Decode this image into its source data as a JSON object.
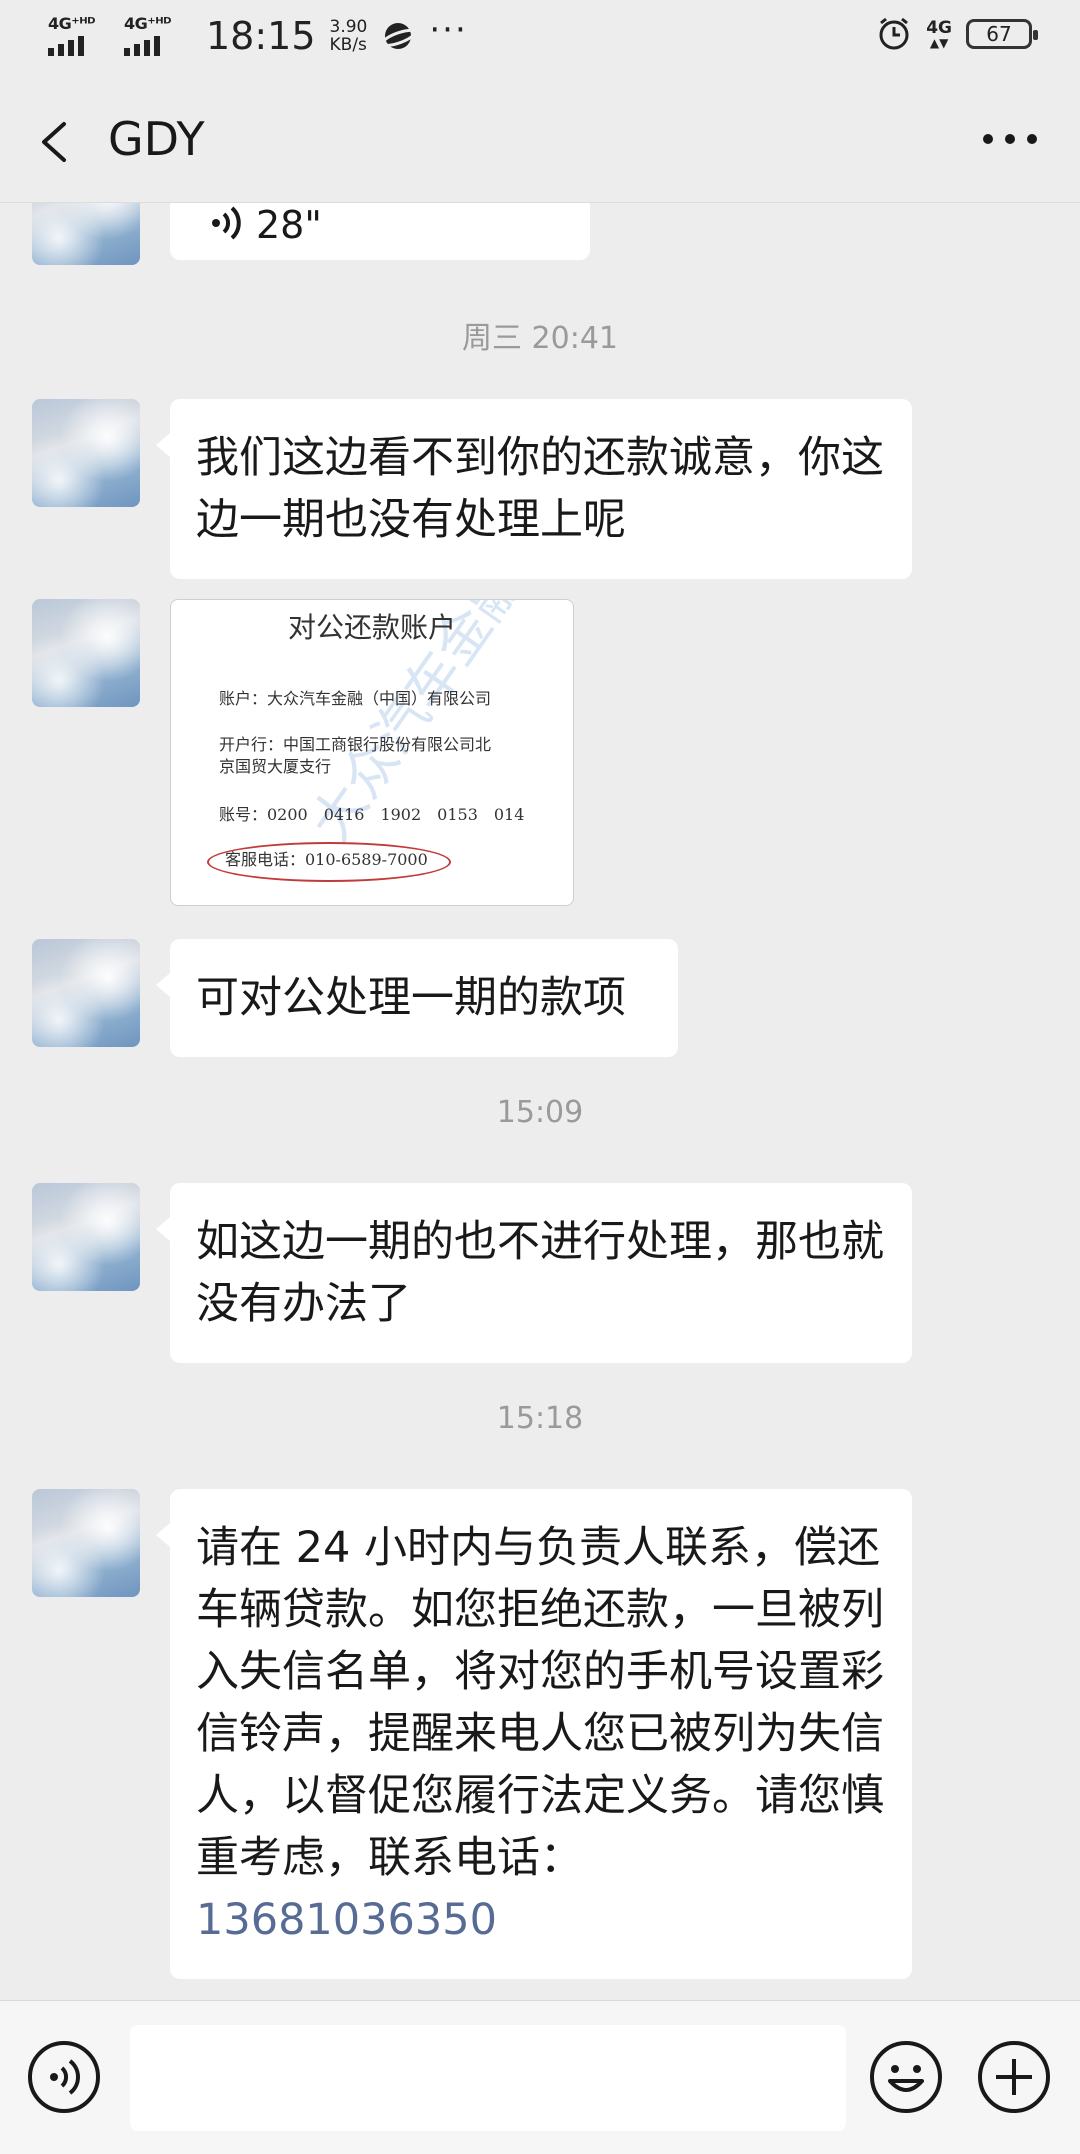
{
  "status_bar": {
    "sim1": "4G⁺ᴴᴰ",
    "sim2": "4G⁺ᴴᴰ",
    "time": "18:15",
    "speed_value": "3.90",
    "speed_unit": "KB/s",
    "network": "4G",
    "battery": "67"
  },
  "header": {
    "title": "GDY"
  },
  "messages": {
    "voice_length": "28\"",
    "time1": "周三 20:41",
    "msg1": "我们这边看不到你的还款诚意，你这边一期也没有处理上呢",
    "image": {
      "title": "对公还款账户",
      "line1": "账户：大众汽车金融（中国）有限公司",
      "line2a": "开户行：中国工商银行股份有限公司北",
      "line2b": "京国贸大厦支行",
      "line3": "账号：0200　0416　1902　0153　014",
      "line4": "客服电话：010-6589-7000",
      "watermark": "大众汽车金融"
    },
    "msg2": "可对公处理一期的款项",
    "time2": "15:09",
    "msg3": "如这边一期的也不进行处理，那也就没有办法了",
    "time3": "15:18",
    "msg4_text": "请在 24 小时内与负责人联系，偿还车辆贷款。如您拒绝还款，一旦被列入失信名单，将对您的手机号设置彩信铃声，提醒来电人您已被列为失信人，以督促您履行法定义务。请您慎重考虑，联系电话：",
    "msg4_phone": "13681036350"
  },
  "colors": {
    "background": "#ededed",
    "bubble": "#ffffff",
    "link": "#576b95",
    "timestamp": "#9a9a9a"
  },
  "icons": [
    "back-arrow-icon",
    "more-icon",
    "voice-icon",
    "emoji-icon",
    "plus-icon",
    "alarm-icon",
    "battery-icon"
  ]
}
